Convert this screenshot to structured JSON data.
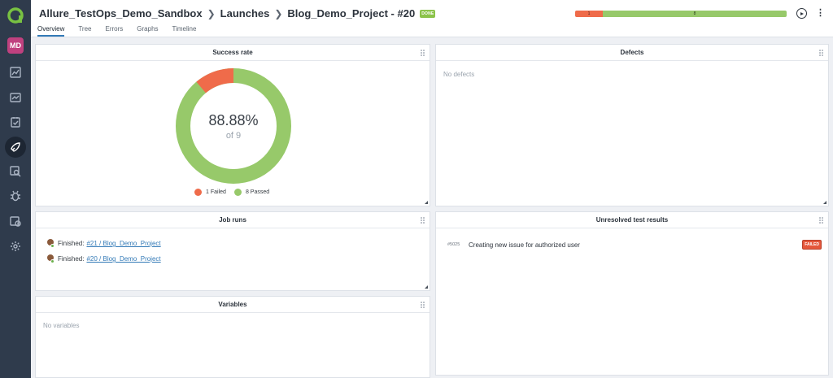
{
  "sidebar": {
    "avatar_initials": "MD",
    "items": [
      {
        "icon": "dashboard-icon"
      },
      {
        "icon": "test-cases-icon"
      },
      {
        "icon": "test-plans-icon"
      },
      {
        "icon": "launches-rocket-icon",
        "active": true
      },
      {
        "icon": "analytics-search-icon"
      },
      {
        "icon": "defects-bug-icon"
      },
      {
        "icon": "jobs-icon"
      },
      {
        "icon": "settings-gear-icon"
      }
    ]
  },
  "header": {
    "breadcrumb": [
      "Allure_TestOps_Demo_Sandbox",
      "Launches",
      "Blog_Demo_Project - #20"
    ],
    "status_badge": "DONE",
    "tabs": [
      "Overview",
      "Tree",
      "Errors",
      "Graphs",
      "Timeline"
    ],
    "active_tab": "Overview",
    "status_bar": {
      "failed": 1,
      "passed": 8
    }
  },
  "widgets": {
    "success_rate": {
      "title": "Success rate",
      "percent": "88.88%",
      "of_label": "of 9",
      "legend": [
        {
          "count": "1",
          "label": "Failed",
          "color": "#ef6b4a"
        },
        {
          "count": "8",
          "label": "Passed",
          "color": "#97c96a"
        }
      ]
    },
    "defects": {
      "title": "Defects",
      "empty": "No defects"
    },
    "job_runs": {
      "title": "Job runs",
      "rows": [
        {
          "status": "Finished:",
          "link": "#21 / Blog_Demo_Project"
        },
        {
          "status": "Finished:",
          "link": "#20 / Blog_Demo_Project"
        }
      ]
    },
    "unresolved": {
      "title": "Unresolved test results",
      "rows": [
        {
          "id": "#5025",
          "name": "Creating new issue for authorized user",
          "status": "FAILED"
        }
      ]
    },
    "variables": {
      "title": "Variables",
      "empty": "No variables"
    }
  },
  "colors": {
    "failed": "#ef6b4a",
    "passed": "#97c96a",
    "sidebar": "#2f3b4c",
    "link": "#337ab7"
  }
}
